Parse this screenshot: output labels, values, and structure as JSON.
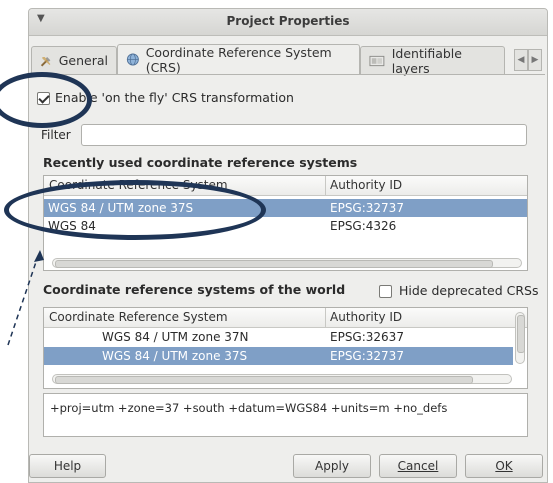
{
  "window": {
    "title": "Project Properties"
  },
  "tabs": [
    {
      "label": "General",
      "icon": "tools-icon"
    },
    {
      "label": "Coordinate Reference System (CRS)",
      "icon": "globe-icon"
    },
    {
      "label": "Identifiable layers",
      "icon": "layers-icon"
    }
  ],
  "otf": {
    "label": "Enable 'on the fly' CRS transformation",
    "checked": true
  },
  "filter": {
    "label": "Filter",
    "value": ""
  },
  "recent": {
    "heading": "Recently used coordinate reference systems",
    "columns": [
      "Coordinate Reference System",
      "Authority ID"
    ],
    "rows": [
      {
        "name": "WGS 84 / UTM zone 37S",
        "authid": "EPSG:32737",
        "selected": true
      },
      {
        "name": "WGS 84",
        "authid": "EPSG:4326",
        "selected": false
      }
    ]
  },
  "world": {
    "heading": "Coordinate reference systems of the world",
    "hide_deprecated": {
      "label": "Hide deprecated CRSs",
      "checked": false
    },
    "columns": [
      "Coordinate Reference System",
      "Authority ID"
    ],
    "rows": [
      {
        "name": "WGS 84 / UTM zone 37N",
        "authid": "EPSG:32637",
        "selected": false
      },
      {
        "name": "WGS 84 / UTM zone 37S",
        "authid": "EPSG:32737",
        "selected": true
      }
    ]
  },
  "proj_string": "+proj=utm +zone=37 +south +datum=WGS84 +units=m +no_defs",
  "buttons": {
    "help": "Help",
    "apply": "Apply",
    "cancel": "Cancel",
    "ok": "OK"
  },
  "colors": {
    "selection": "#7f9fc6",
    "annotation": "#1f3556"
  }
}
